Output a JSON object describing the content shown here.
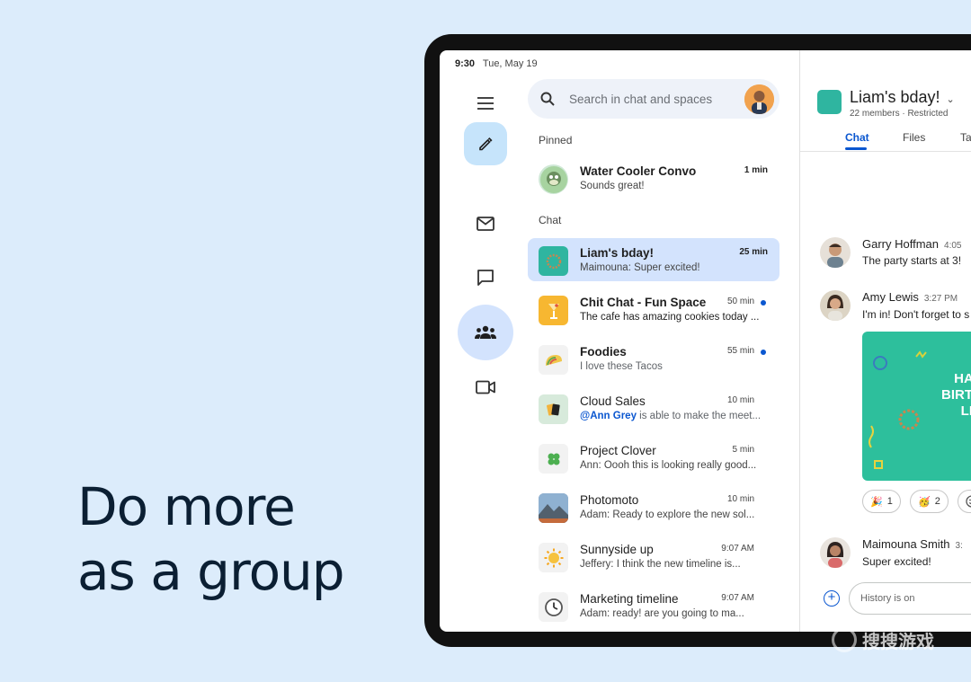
{
  "headline": {
    "line1": "Do more",
    "line2": "as a group"
  },
  "status": {
    "time": "9:30",
    "date": "Tue, May 19"
  },
  "rail": {
    "icons": [
      "menu-icon",
      "pencil-icon",
      "mail-icon",
      "chat-bubble-icon",
      "groups-icon",
      "video-icon"
    ]
  },
  "search": {
    "placeholder": "Search in chat and spaces"
  },
  "sections": {
    "pinned": "Pinned",
    "chat": "Chat"
  },
  "pinned": [
    {
      "name": "Water Cooler Convo",
      "message": "Sounds great!",
      "time": "1 min"
    }
  ],
  "chats": [
    {
      "name": "Liam's bday!",
      "message": "Maimouna: Super excited!",
      "time": "25 min",
      "selected": true
    },
    {
      "name": "Chit Chat - Fun Space",
      "message": "The cafe has amazing cookies today ...",
      "time": "50 min",
      "unread": true
    },
    {
      "name": "Foodies",
      "message": "I love these Tacos",
      "time": "55 min",
      "unread": true
    },
    {
      "name": "Cloud Sales",
      "mention": "@Ann Grey",
      "message": " is able to make the meet...",
      "time": "10 min"
    },
    {
      "name": "Project Clover",
      "message": "Ann: Oooh this is looking really good...",
      "time": "5 min"
    },
    {
      "name": "Photomoto",
      "message": "Adam: Ready to explore the new sol...",
      "time": "10 min"
    },
    {
      "name": "Sunnyside up",
      "message": "Jeffery: I think the new timeline is...",
      "time": "9:07 AM"
    },
    {
      "name": "Marketing timeline",
      "message": "Adam: ready! are you going to ma...",
      "time": "9:07 AM"
    }
  ],
  "channel": {
    "title": "Liam's bday!",
    "subtitle": "22 members · Restricted",
    "tabs": [
      "Chat",
      "Files",
      "Ta"
    ]
  },
  "messages": [
    {
      "name": "Garry Hoffman",
      "time": "4:05",
      "text": "The party starts at 3!"
    },
    {
      "name": "Amy Lewis",
      "time": "3:27 PM",
      "text": "I'm in! Don't forget to s"
    },
    {
      "name": "Maimouna Smith",
      "time": "3:",
      "text": "Super excited!"
    }
  ],
  "card": {
    "line1": "HAP",
    "line2": "BIRTH",
    "line3": "LIA"
  },
  "reactions": [
    {
      "emoji": "🎉",
      "count": "1"
    },
    {
      "emoji": "🥳",
      "count": "2"
    }
  ],
  "composer": {
    "placeholder": "History is on"
  },
  "watermark": {
    "text": "搜搜游戏"
  },
  "colors": {
    "background": "#dcecfb",
    "accent": "#0b57d0",
    "selected": "#d3e3fd",
    "compose": "#c6e4fb"
  }
}
